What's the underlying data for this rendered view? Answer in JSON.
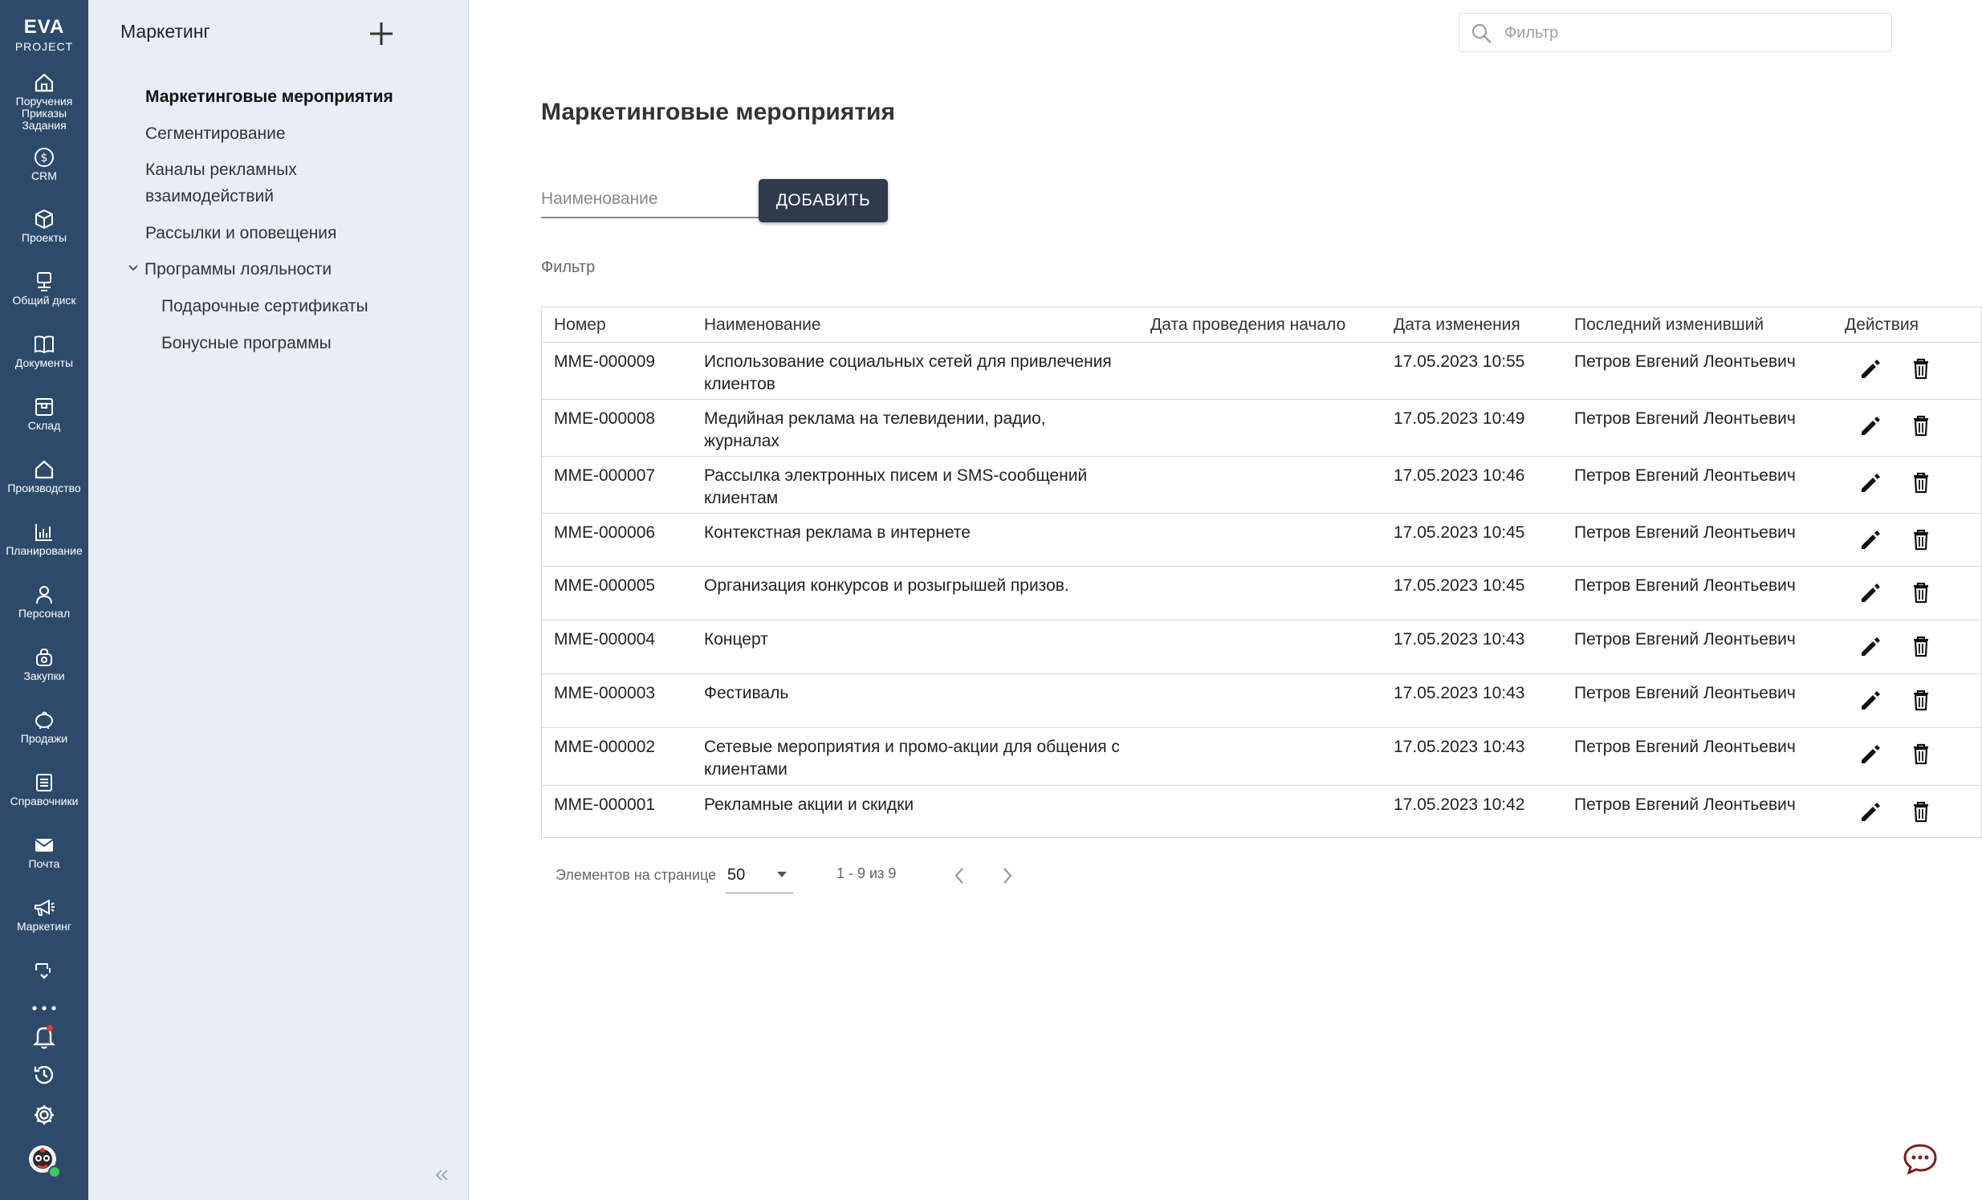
{
  "rail": {
    "logo_line1": "EVA",
    "logo_line2": "PROJECT",
    "items": [
      {
        "label": "Поручения\nПриказы\nЗадания",
        "icon": "home-icon"
      },
      {
        "label": "CRM",
        "icon": "dollar-icon"
      },
      {
        "label": "Проекты",
        "icon": "cube-icon"
      },
      {
        "label": "Общий диск",
        "icon": "disk-icon"
      },
      {
        "label": "Документы",
        "icon": "book-icon"
      },
      {
        "label": "Склад",
        "icon": "warehouse-icon"
      },
      {
        "label": "Производство",
        "icon": "factory-icon"
      },
      {
        "label": "Планирование",
        "icon": "chart-icon"
      },
      {
        "label": "Персонал",
        "icon": "person-icon"
      },
      {
        "label": "Закупки",
        "icon": "basket-icon"
      },
      {
        "label": "Продажи",
        "icon": "piggy-icon"
      },
      {
        "label": "Справочники",
        "icon": "list-icon"
      },
      {
        "label": "Почта",
        "icon": "mail-icon"
      },
      {
        "label": "Маркетинг",
        "icon": "megaphone-icon"
      }
    ]
  },
  "sidebar": {
    "title": "Маркетинг",
    "items": [
      {
        "label": "Маркетинговые мероприятия"
      },
      {
        "label": "Сегментирование"
      },
      {
        "label": "Каналы рекламных"
      },
      {
        "label": "взаимодействий"
      },
      {
        "label": "Рассылки и оповещения"
      },
      {
        "label": "Программы лояльности"
      },
      {
        "label": "Подарочные сертификаты"
      },
      {
        "label": "Бонусные программы"
      }
    ]
  },
  "search": {
    "placeholder": "Фильтр"
  },
  "main": {
    "title": "Маркетинговые мероприятия",
    "name_placeholder": "Наименование",
    "add_label": "ДОБАВИТЬ",
    "filter_label": "Фильтр"
  },
  "table": {
    "headers": [
      "Номер",
      "Наименование",
      "Дата проведения начало",
      "Дата изменения",
      "Последний изменивший",
      "Действия"
    ],
    "rows": [
      {
        "num": "MME-000009",
        "name": "Использование социальных сетей для привлечения клиентов",
        "start": "",
        "changed": "17.05.2023 10:55",
        "user": "Петров Евгений Леонтьевич"
      },
      {
        "num": "MME-000008",
        "name": "Медийная реклама на телевидении, радио, журналах",
        "start": "",
        "changed": "17.05.2023 10:49",
        "user": "Петров Евгений Леонтьевич"
      },
      {
        "num": "MME-000007",
        "name": "Рассылка электронных писем и SMS-сообщений клиентам",
        "start": "",
        "changed": "17.05.2023 10:46",
        "user": "Петров Евгений Леонтьевич"
      },
      {
        "num": "MME-000006",
        "name": "Контекстная реклама в интернете",
        "start": "",
        "changed": "17.05.2023 10:45",
        "user": "Петров Евгений Леонтьевич"
      },
      {
        "num": "MME-000005",
        "name": "Организация конкурсов и розыгрышей призов.",
        "start": "",
        "changed": "17.05.2023 10:45",
        "user": "Петров Евгений Леонтьевич"
      },
      {
        "num": "MME-000004",
        "name": "Концерт",
        "start": "",
        "changed": "17.05.2023 10:43",
        "user": "Петров Евгений Леонтьевич"
      },
      {
        "num": "MME-000003",
        "name": "Фестиваль",
        "start": "",
        "changed": "17.05.2023 10:43",
        "user": "Петров Евгений Леонтьевич"
      },
      {
        "num": "MME-000002",
        "name": "Сетевые мероприятия и промо-акции для общения с клиентами",
        "start": "",
        "changed": "17.05.2023 10:43",
        "user": "Петров Евгений Леонтьевич"
      },
      {
        "num": "MME-000001",
        "name": "Рекламные акции и скидки",
        "start": "",
        "changed": "17.05.2023 10:42",
        "user": "Петров Евгений Леонтьевич"
      }
    ]
  },
  "pager": {
    "label": "Элементов на странице",
    "page_size": "50",
    "range": "1 - 9 из 9"
  },
  "colors": {
    "rail": "#2e4a6b",
    "sidebar": "#e7eef6",
    "button": "#2f3a4d",
    "notification_dot": "#e53935",
    "online_dot": "#43c463",
    "chat": "#7a1f1f"
  }
}
